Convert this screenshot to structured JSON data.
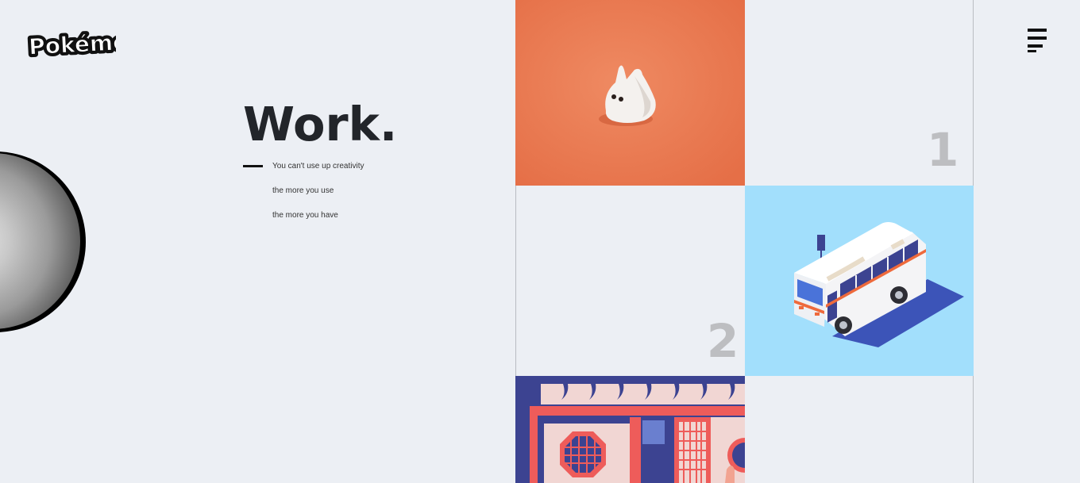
{
  "brand": {
    "logo_text": "Pokémon",
    "logo_icon": "pokemon-logo"
  },
  "nav": {
    "menu_icon": "hamburger-icon"
  },
  "hero": {
    "title": "Work.",
    "lines": [
      "You can't use up creativity",
      "the more you use",
      "the more you have"
    ]
  },
  "grid": {
    "tiles": [
      {
        "kind": "image",
        "label": "white-rabbit-figurine",
        "background": "#ea7a51"
      },
      {
        "kind": "number",
        "value": "1"
      },
      {
        "kind": "number",
        "value": "2"
      },
      {
        "kind": "image",
        "label": "isometric-bus",
        "background": "#a2dffc"
      },
      {
        "kind": "image",
        "label": "chinese-storefront",
        "background": "#f1d6d3"
      },
      {
        "kind": "blank"
      }
    ]
  },
  "colors": {
    "background": "#eceff4",
    "title": "#22252a",
    "number": "#bdbec1",
    "orange": "#ea7a51",
    "sky_blue": "#a2dffc",
    "navy": "#3c4391",
    "coral_red": "#ee5c5a"
  }
}
